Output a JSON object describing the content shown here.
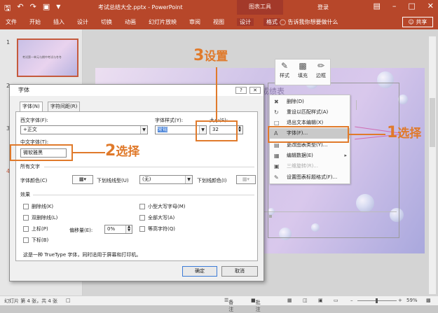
{
  "title_bar": {
    "doc_title": "考试总结大全.pptx - PowerPoint",
    "contextual_tab_group": "图表工具",
    "login": "登录",
    "qat": [
      "save",
      "undo",
      "redo",
      "slideshow"
    ]
  },
  "ribbon": {
    "tabs": [
      "文件",
      "开始",
      "插入",
      "设计",
      "切换",
      "动画",
      "幻灯片放映",
      "审阅",
      "视图",
      "设计",
      "格式"
    ],
    "tell_me": "告诉我你想要做什么",
    "share": "共享"
  },
  "thumbnails": {
    "slide1_num": "1",
    "slide1_text": "考试第一单元与期中考试与冬冬",
    "slide_numbers": [
      "2",
      "3",
      "4"
    ]
  },
  "slide": {
    "title": "成绩表"
  },
  "mini_toolbar": {
    "buttons": [
      "样式",
      "填充",
      "边框"
    ]
  },
  "context_menu": {
    "items": [
      {
        "label": "删除(D)",
        "icon": "delete-icon",
        "state": "normal"
      },
      {
        "label": "重设以匹配样式(A)",
        "icon": "reset-icon",
        "state": "normal"
      },
      {
        "label": "退出文本编辑(X)",
        "icon": "exit-text-icon",
        "state": "normal"
      },
      {
        "label": "字体(F)...",
        "icon": "font-A-icon",
        "state": "highlighted"
      },
      {
        "label": "更改图表类型(Y)...",
        "icon": "chart-type-icon",
        "state": "normal"
      },
      {
        "label": "编辑数据(E)",
        "icon": "edit-data-icon",
        "state": "normal",
        "submenu": true
      },
      {
        "label": "三维旋转(R)...",
        "icon": "rotate-icon",
        "state": "disabled"
      },
      {
        "label": "设置图表标题格式(F)...",
        "icon": "format-title-icon",
        "state": "normal"
      }
    ]
  },
  "font_dialog": {
    "title": "字体",
    "tabs": [
      "字体(N)",
      "字符间距(R)"
    ],
    "latin_font_label": "西文字体(F):",
    "latin_font_value": "+正文",
    "font_style_label": "字体样式(Y):",
    "font_style_value": "常规",
    "size_label": "大小(S):",
    "size_value": "32",
    "asian_font_label": "中文字体(T):",
    "asian_font_value": "微软雅黑",
    "all_text_label": "所有文字",
    "font_color_label": "字体颜色(C)",
    "underline_type_label": "下划线线型(U)",
    "underline_type_value": "(无)",
    "underline_color_label": "下划线颜色(I)",
    "effects_label": "效果",
    "effects_left": [
      "删除线(K)",
      "双删除线(L)",
      "上标(P)",
      "下标(B)"
    ],
    "effects_right": [
      "小型大写字母(M)",
      "全部大写(A)",
      "等高字符(Q)"
    ],
    "offset_label": "偏移量(E):",
    "offset_value": "0%",
    "description": "这是一种 TrueType 字体，同时适用于屏幕和打印机。",
    "ok": "确定",
    "cancel": "取消"
  },
  "annotations": {
    "step1_num": "1",
    "step1_text": "选择",
    "step2_num": "2",
    "step2_text": "选择",
    "step3_num": "3",
    "step3_text": "设置"
  },
  "status_bar": {
    "slide_info": "幻灯片 第 4 张，共 4 张",
    "notes": "备注",
    "comments": "批注",
    "zoom": "59%"
  },
  "colors": {
    "accent": "#b7472a",
    "annotation": "#e07a2b",
    "highlight": "#c9c9c9"
  }
}
